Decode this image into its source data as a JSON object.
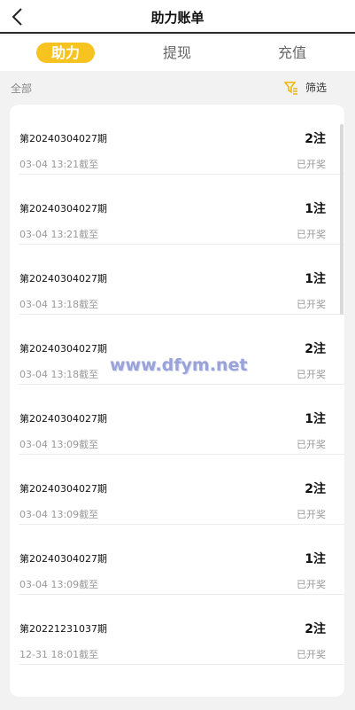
{
  "header": {
    "title": "助力账单"
  },
  "tabs": [
    {
      "label": "助力",
      "active": true
    },
    {
      "label": "提现",
      "active": false
    },
    {
      "label": "充值",
      "active": false
    }
  ],
  "subbar": {
    "all_label": "全部",
    "filter_label": "筛选"
  },
  "colors": {
    "accent": "#f7c320",
    "filter_icon": "#f0b400"
  },
  "records": [
    {
      "issue": "第20240304027期",
      "count": "2注",
      "deadline": "03-04 13:21截至",
      "status": "已开奖"
    },
    {
      "issue": "第20240304027期",
      "count": "1注",
      "deadline": "03-04 13:21截至",
      "status": "已开奖"
    },
    {
      "issue": "第20240304027期",
      "count": "1注",
      "deadline": "03-04 13:18截至",
      "status": "已开奖"
    },
    {
      "issue": "第20240304027期",
      "count": "2注",
      "deadline": "03-04 13:18截至",
      "status": "已开奖"
    },
    {
      "issue": "第20240304027期",
      "count": "1注",
      "deadline": "03-04 13:09截至",
      "status": "已开奖"
    },
    {
      "issue": "第20240304027期",
      "count": "2注",
      "deadline": "03-04 13:09截至",
      "status": "已开奖"
    },
    {
      "issue": "第20240304027期",
      "count": "1注",
      "deadline": "03-04 13:09截至",
      "status": "已开奖"
    },
    {
      "issue": "第20221231037期",
      "count": "2注",
      "deadline": "12-31 18:01截至",
      "status": "已开奖"
    }
  ],
  "watermark": "www.dfym.net"
}
